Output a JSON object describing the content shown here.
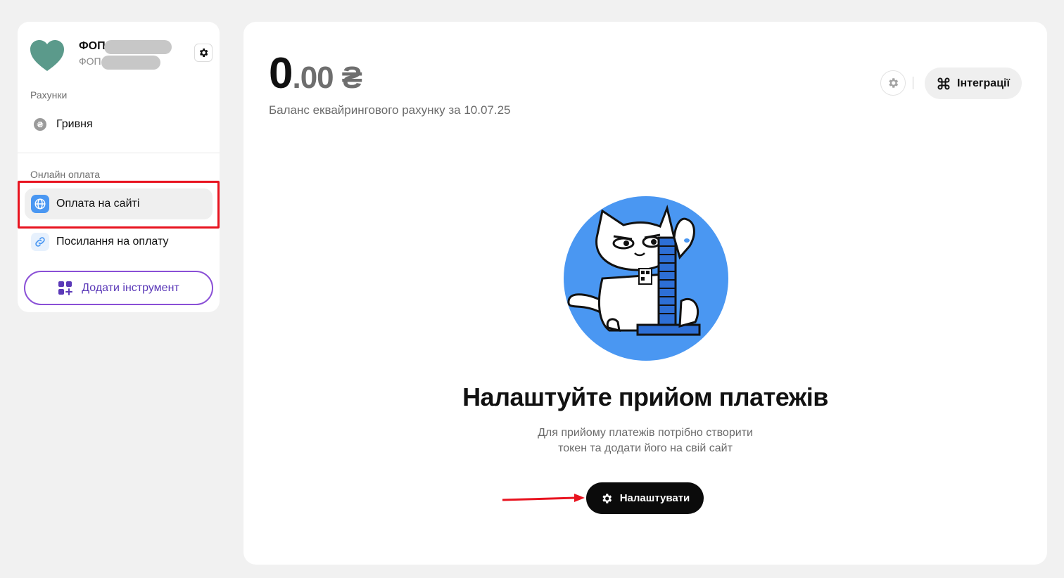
{
  "sidebar": {
    "profile": {
      "name": "ФОП",
      "subtitle": "ФОП"
    },
    "accounts_label": "Рахунки",
    "accounts": [
      {
        "label": "Гривня",
        "icon": "hryvnia-coin-icon"
      }
    ],
    "online_label": "Онлайн оплата",
    "online_items": [
      {
        "label": "Оплата на сайті",
        "icon": "globe-icon",
        "active": true
      },
      {
        "label": "Посилання на оплату",
        "icon": "link-icon",
        "active": false
      }
    ],
    "add_tool_label": "Додати інструмент"
  },
  "main": {
    "balance": {
      "integer": "0",
      "decimal": ".00",
      "currency": "₴"
    },
    "balance_caption": "Баланс еквайрингового рахунку за 10.07.25",
    "integrations_label": "Інтеграції",
    "empty_state": {
      "title": "Налаштуйте прийом платежів",
      "description_line1": "Для прийому платежів потрібно створити",
      "description_line2": "токен та додати його на свій сайт",
      "button_label": "Налаштувати"
    }
  },
  "colors": {
    "accent_red": "#e8131f",
    "accent_purple": "#8a4fd6",
    "avatar_teal": "#5b9a8b",
    "illustration_blue": "#4a97f2"
  }
}
